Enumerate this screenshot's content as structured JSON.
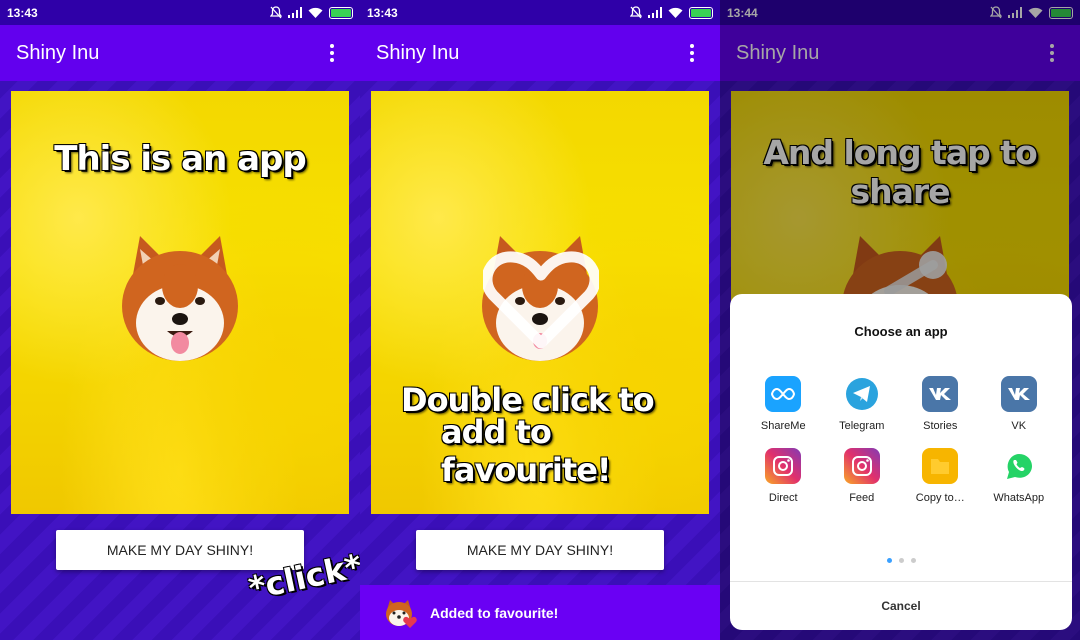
{
  "app": {
    "title": "Shiny Inu"
  },
  "colors": {
    "app_bar": "#6200ee",
    "background": "#3a0fb8",
    "status_bar": "#2f00a8",
    "photo_yellow": "#f3d800",
    "snackbar": "#6a00f4"
  },
  "panels": [
    {
      "status_time": "13:43",
      "caption": "This is an app",
      "button_label": "MAKE MY DAY SHINY!",
      "click_text": "*click*"
    },
    {
      "status_time": "13:43",
      "caption_line1": "Double click to",
      "caption_line2": "add to favourite!",
      "button_label": "MAKE MY DAY SHINY!",
      "snackbar_text": "Added to favourite!"
    },
    {
      "status_time": "13:44",
      "caption": "And long tap to share",
      "share_sheet": {
        "title": "Choose an app",
        "apps": [
          {
            "label": "ShareMe",
            "icon": "shareme-icon",
            "color": "#1aa3ff"
          },
          {
            "label": "Telegram",
            "icon": "telegram-icon",
            "color": "#2aa3de"
          },
          {
            "label": "Stories",
            "icon": "vk-icon",
            "color": "#4a76a8"
          },
          {
            "label": "VK",
            "icon": "vk-icon",
            "color": "#4a76a8"
          },
          {
            "label": "Direct",
            "icon": "instagram-icon",
            "color": "#d6249f"
          },
          {
            "label": "Feed",
            "icon": "instagram-icon",
            "color": "#d6249f"
          },
          {
            "label": "Copy to…",
            "icon": "folder-icon",
            "color": "#f7b500"
          },
          {
            "label": "WhatsApp",
            "icon": "whatsapp-icon",
            "color": "#25d366"
          }
        ],
        "cancel_label": "Cancel"
      }
    }
  ]
}
